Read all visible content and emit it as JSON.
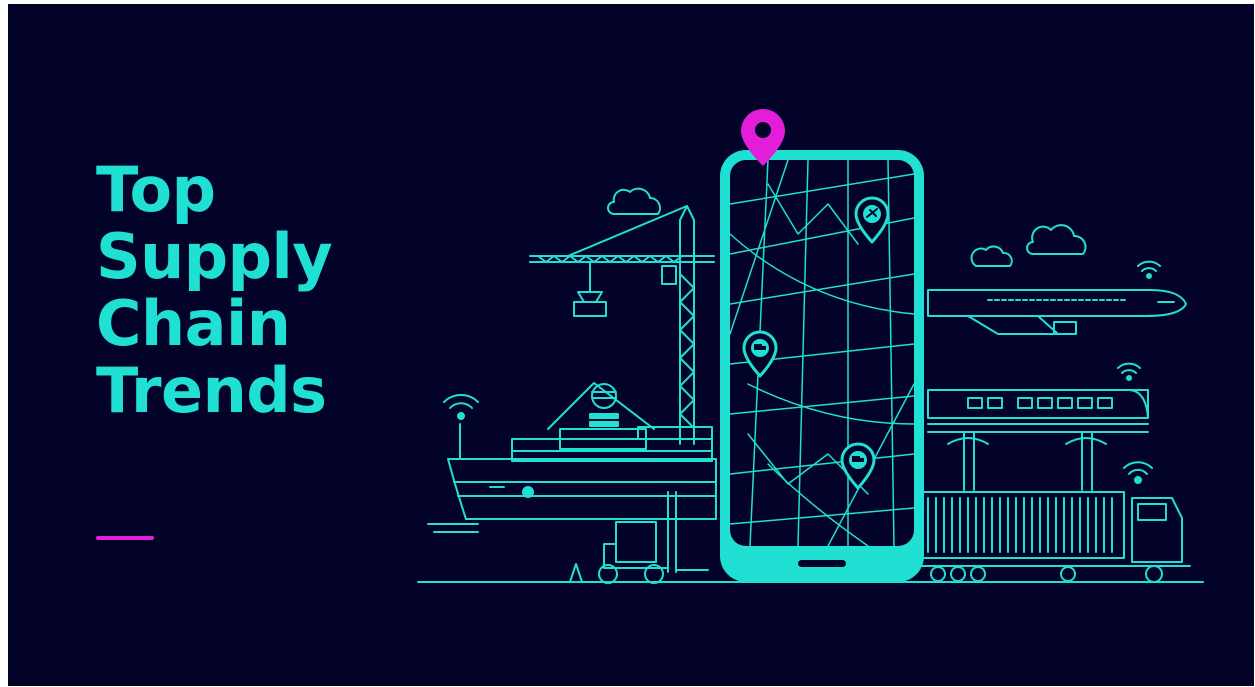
{
  "banner": {
    "title_lines": [
      "Top",
      "Supply",
      "Chain",
      "Trends"
    ]
  },
  "colors": {
    "background": "#03032a",
    "accent": "#1fe0d2",
    "highlight": "#e41ed8"
  },
  "illustration": {
    "phone_pins": [
      "airplane-icon",
      "delivery-truck-icon",
      "delivery-truck-icon"
    ],
    "top_pin": "location-pin-icon",
    "scene": [
      "cargo-ship",
      "port-crane",
      "forklift",
      "airplane",
      "train",
      "container-truck",
      "clouds",
      "wifi-signals"
    ]
  }
}
